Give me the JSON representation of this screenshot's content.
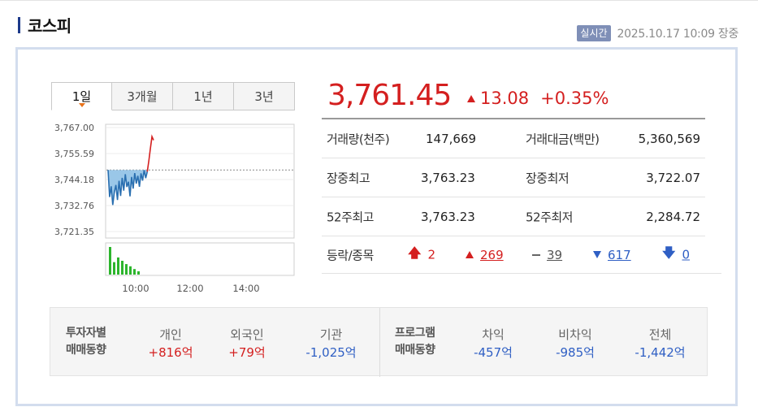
{
  "header": {
    "title": "코스피",
    "realtime_badge": "실시간",
    "datetime": "2025.10.17 10:09 장중"
  },
  "tabs": [
    {
      "label": "1일",
      "active": true
    },
    {
      "label": "3개월",
      "active": false
    },
    {
      "label": "1년",
      "active": false
    },
    {
      "label": "3년",
      "active": false
    }
  ],
  "chart_data": {
    "type": "line",
    "y_ticks": [
      "3,767.00",
      "3,755.59",
      "3,744.18",
      "3,732.76",
      "3,721.35"
    ],
    "ylim": [
      3721.35,
      3767.0
    ],
    "x_ticks": [
      "10:00",
      "12:00",
      "14:00"
    ],
    "reference_line": 3748.37,
    "series": [
      {
        "values": [
          3748.4,
          3736.5,
          3741.2,
          3733.0,
          3738.5,
          3741.8,
          3735.2,
          3743.6,
          3737.0,
          3744.9,
          3739.3,
          3746.5,
          3740.9,
          3743.2,
          3736.8,
          3745.3,
          3740.2,
          3747.0,
          3742.4,
          3745.8,
          3741.0,
          3746.9,
          3743.7,
          3748.3,
          3744.8,
          3747.6,
          3752.4,
          3757.9,
          3763.0,
          3761.45
        ]
      }
    ],
    "volume": [
      1.0,
      0.45,
      0.62,
      0.5,
      0.38,
      0.3,
      0.2,
      0.12
    ]
  },
  "quote": {
    "price": "3,761.45",
    "change": "13.08",
    "change_pct": "+0.35%"
  },
  "stats": [
    {
      "l1": "거래량(천주)",
      "v1": "147,669",
      "l2": "거래대금(백만)",
      "v2": "5,360,569"
    },
    {
      "l1": "장중최고",
      "v1": "3,763.23",
      "l2": "장중최저",
      "v2": "3,722.07"
    },
    {
      "l1": "52주최고",
      "v1": "3,763.23",
      "l2": "52주최저",
      "v2": "2,284.72"
    }
  ],
  "breadth": {
    "label": "등락/종목",
    "upper_limit": "2",
    "up": "269",
    "flat": "39",
    "down": "617",
    "lower_limit": "0"
  },
  "investors": {
    "label1a": "투자자별",
    "label1b": "매매동향",
    "label2a": "프로그램",
    "label2b": "매매동향",
    "items": [
      {
        "name": "개인",
        "value": "+816억"
      },
      {
        "name": "외국인",
        "value": "+79억"
      },
      {
        "name": "기관",
        "value": "-1,025억"
      },
      {
        "name": "차익",
        "value": "-457억"
      },
      {
        "name": "비차익",
        "value": "-985억"
      },
      {
        "name": "전체",
        "value": "-1,442억"
      }
    ]
  },
  "colors": {
    "up": "#d41f1f",
    "down": "#2f5fc4",
    "line_blue": "#2a6fb0",
    "volume_green": "#2db52d"
  }
}
